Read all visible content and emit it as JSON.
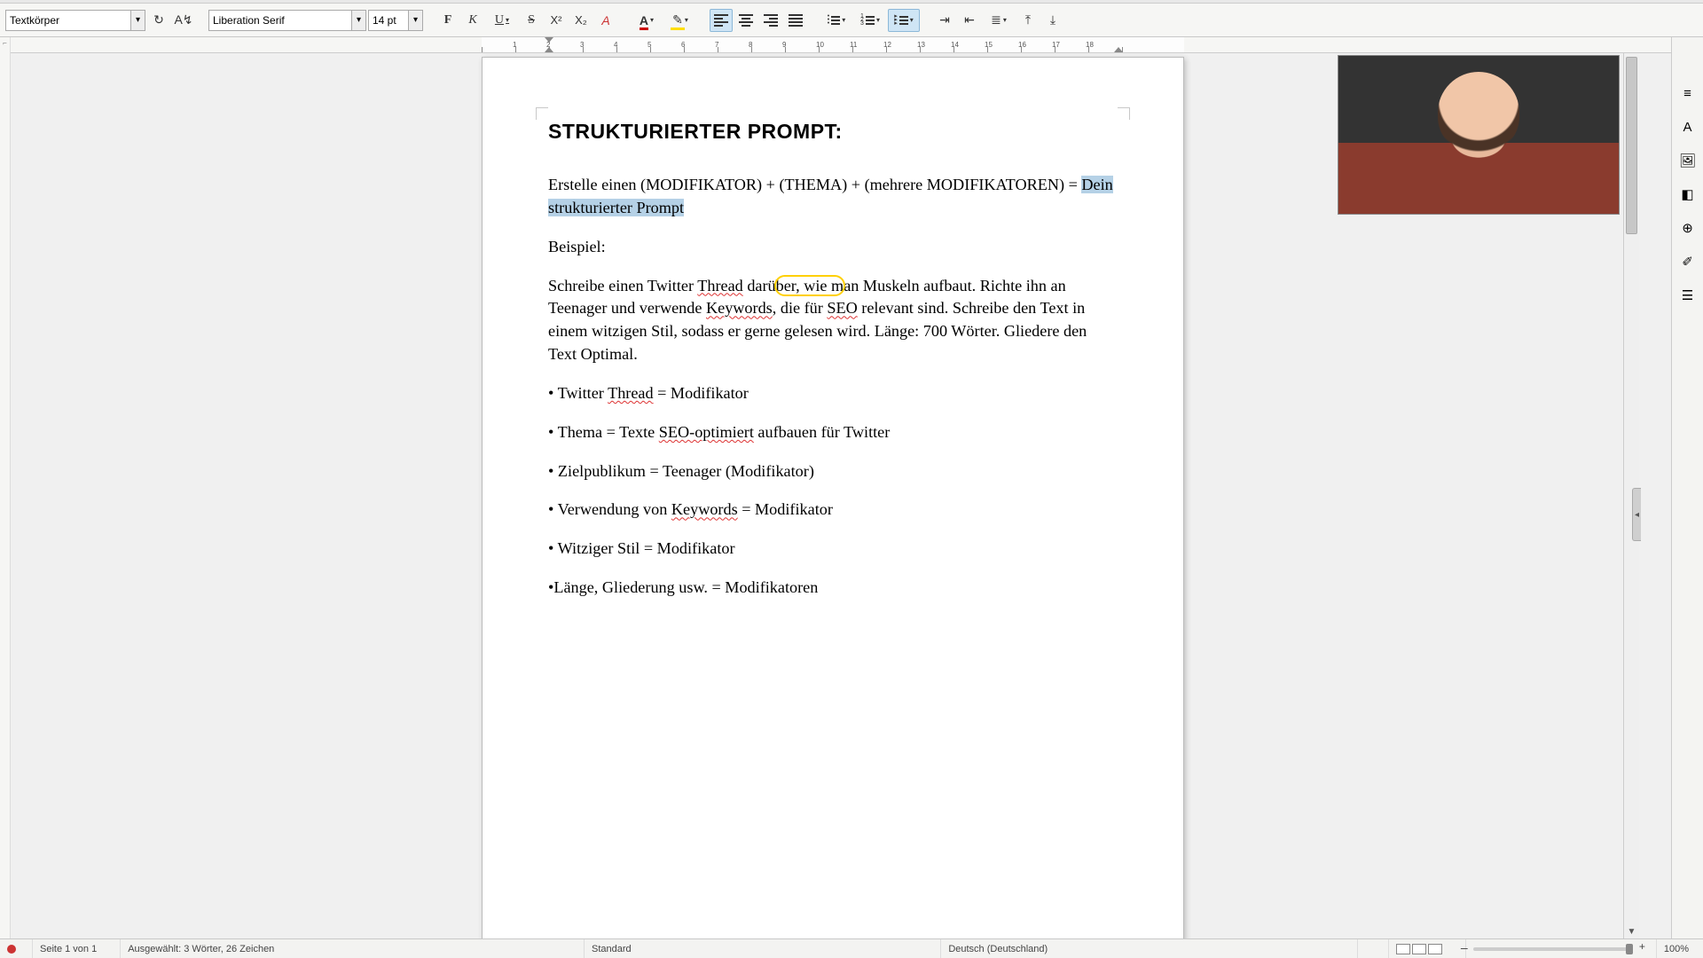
{
  "toolbar": {
    "para_style": "Textkörper",
    "font_name": "Liberation Serif",
    "font_size": "14 pt",
    "bold": "F",
    "italic": "K",
    "underline": "U",
    "strike": "S",
    "superscript": "X²",
    "subscript": "X₂",
    "clear_format": "A",
    "font_color_letter": "A",
    "highlight_glyph": "✎"
  },
  "ruler": {
    "ticks": [
      "",
      "1",
      "2",
      "3",
      "4",
      "5",
      "6",
      "7",
      "8",
      "9",
      "10",
      "11",
      "12",
      "13",
      "14",
      "15",
      "16",
      "17",
      "18",
      ""
    ]
  },
  "document": {
    "heading": "STRUKTURIERTER PROMPT:",
    "formula_pre": "Erstelle einen (MODIFIKATOR) + (THEMA) + (mehrere MODIFIKATOREN) = ",
    "formula_sel": "Dein strukturierter Prompt",
    "beispiel": "Beispiel:",
    "ex_s1a": "Schreibe einen Twitter ",
    "ex_s1b": "Thread",
    "ex_s1c": " darü",
    "ex_s1d": "ber, wie m",
    "ex_s1e": "an Muskeln aufbaut. Richte ihn an Teenager und verwende ",
    "ex_s2a": "Keywords",
    "ex_s2b": ", die für ",
    "ex_s2c": "SEO",
    "ex_s2d": " relevant sind. Schreibe den Text in einem witzigen Stil, sodass er gerne ",
    "ex_s2e": "gelesen",
    "ex_s2f": " wird. Länge: 700 Wörter. Gliedere den Text Optimal.",
    "bullets": [
      {
        "pre": "• Twitter ",
        "sq": "Thread",
        "post": " = Modifikator"
      },
      {
        "pre": "• Thema = Texte ",
        "sq": "SEO-optimiert",
        "post": " aufbauen für Twitter"
      },
      {
        "pre": "• Zielpublikum = Teenager (Modifikator)",
        "sq": "",
        "post": ""
      },
      {
        "pre": "• Verwendung von ",
        "sq": "Keywords",
        "post": " = Modifikator"
      },
      {
        "pre": "• Witziger Stil = Modifikator",
        "sq": "",
        "post": ""
      },
      {
        "pre": "•Länge, Gliederung usw. = Modifikatoren",
        "sq": "",
        "post": ""
      }
    ]
  },
  "sidepanel": {
    "icons": [
      "≡",
      "A",
      "🖼",
      "◧",
      "⊕",
      "✐",
      "☰"
    ]
  },
  "status": {
    "page": "Seite 1 von 1",
    "selection": "Ausgewählt: 3 Wörter, 26 Zeichen",
    "style": "Standard",
    "language": "Deutsch (Deutschland)",
    "insert": "",
    "zoom_center": "— + 0 —",
    "zoom_pct": "100%"
  }
}
